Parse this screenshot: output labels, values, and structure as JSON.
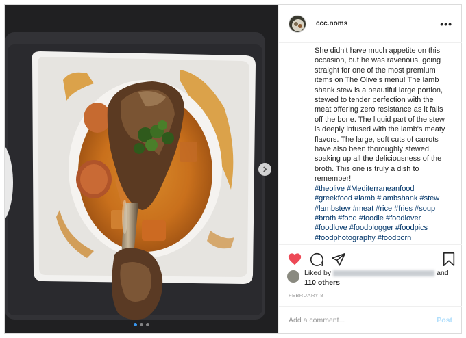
{
  "post": {
    "username": "ccc.noms",
    "more_label": "•••",
    "caption_main": "She didn't have much appetite on this occasion, but he was ravenous, going straight for one of the most premium items on The Olive's menu! The lamb shank stew is a beautiful large portion, stewed to tender perfection with the meat offering zero resistance as it falls off the bone. The liquid part of the stew is deeply infused with the lamb's meaty flavors. The large, soft cuts of carrots have also been thoroughly stewed, soaking up all the deliciousness of the broth. This one is truly a dish to remember!",
    "caption_hashtags": "#theolive #Mediterraneanfood #greekfood #lamb #lambshank #stew #lambstew #meat #rice #fries #soup #broth #food #foodie #foodlover #foodlove #foodblogger #foodpics #foodphotography #foodporn",
    "likes_prefix": "Liked by",
    "likes_and": "and",
    "likes_others": "110 others",
    "date": "FEBRUARY 8",
    "comment_placeholder": "Add a comment...",
    "post_label": "Post",
    "carousel": {
      "total": 3,
      "active": 1
    }
  },
  "icons": {
    "like": "heart-icon",
    "comment": "comment-icon",
    "share": "share-icon",
    "save": "bookmark-icon",
    "next": "chevron-right-icon",
    "more": "more-icon"
  },
  "colors": {
    "like_active": "#ed4956",
    "hashtag": "#003569",
    "carousel_active": "#3897f0",
    "post_button": "#b2dffc"
  }
}
